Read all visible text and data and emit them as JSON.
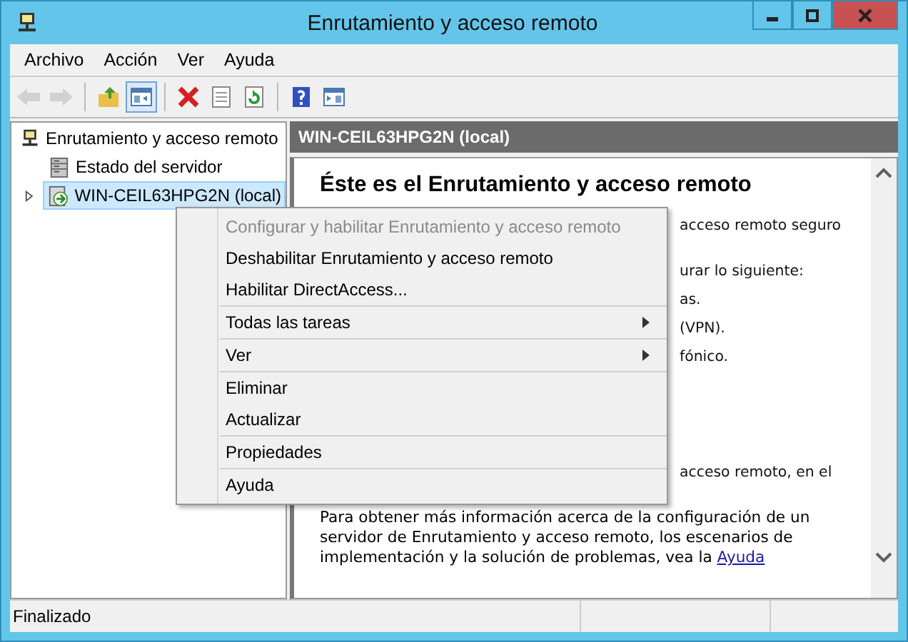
{
  "window": {
    "title": "Enrutamiento y acceso remoto"
  },
  "menu_bar": [
    "Archivo",
    "Acción",
    "Ver",
    "Ayuda"
  ],
  "toolbar": [
    [
      {
        "kind": "back",
        "disabled": true,
        "pressed": false
      },
      {
        "kind": "forward",
        "disabled": true,
        "pressed": false
      }
    ],
    [
      {
        "kind": "up",
        "disabled": false,
        "pressed": false
      },
      {
        "kind": "tree",
        "disabled": false,
        "pressed": true
      }
    ],
    [
      {
        "kind": "delete",
        "disabled": false,
        "pressed": false
      },
      {
        "kind": "properties",
        "disabled": false,
        "pressed": false
      },
      {
        "kind": "refresh",
        "disabled": false,
        "pressed": false
      }
    ],
    [
      {
        "kind": "help",
        "disabled": false,
        "pressed": false
      },
      {
        "kind": "pane",
        "disabled": false,
        "pressed": false
      }
    ]
  ],
  "tree": [
    {
      "label": "Enrutamiento y acceso remoto",
      "kind": "root",
      "selected": false,
      "children": [
        {
          "label": "Estado del servidor",
          "kind": "status",
          "selected": false
        },
        {
          "label": "WIN-CEIL63HPG2N (local)",
          "kind": "server",
          "selected": true,
          "expanded": false
        }
      ]
    }
  ],
  "details": {
    "header": "WIN-CEIL63HPG2N (local)",
    "heading": "Éste es el Enrutamiento y acceso remoto",
    "covered_text_blocks": [
      [
        "acceso remoto seguro"
      ],
      [
        "urar lo siguiente:",
        "as.",
        "(VPN).",
        "fónico."
      ],
      [
        "acceso remoto, en el"
      ]
    ],
    "paragraph": "Para obtener más información acerca de la configuración de un servidor de Enrutamiento y acceso remoto, los escenarios de implementación y la solución de problemas, vea la",
    "link": "Ayuda"
  },
  "context_menu": [
    [
      {
        "label": "Configurar y habilitar Enrutamiento y acceso remoto",
        "disabled": true,
        "submenu": false
      },
      {
        "label": "Deshabilitar Enrutamiento y acceso remoto",
        "disabled": false,
        "submenu": false
      },
      {
        "label": "Habilitar DirectAccess...",
        "disabled": false,
        "submenu": false
      }
    ],
    [
      {
        "label": "Todas las tareas",
        "disabled": false,
        "submenu": true
      }
    ],
    [
      {
        "label": "Ver",
        "disabled": false,
        "submenu": true
      }
    ],
    [
      {
        "label": "Eliminar",
        "disabled": false,
        "submenu": false
      },
      {
        "label": "Actualizar",
        "disabled": false,
        "submenu": false
      }
    ],
    [
      {
        "label": "Propiedades",
        "disabled": false,
        "submenu": false
      }
    ],
    [
      {
        "label": "Ayuda",
        "disabled": false,
        "submenu": false
      }
    ]
  ],
  "status_bar": "Finalizado"
}
